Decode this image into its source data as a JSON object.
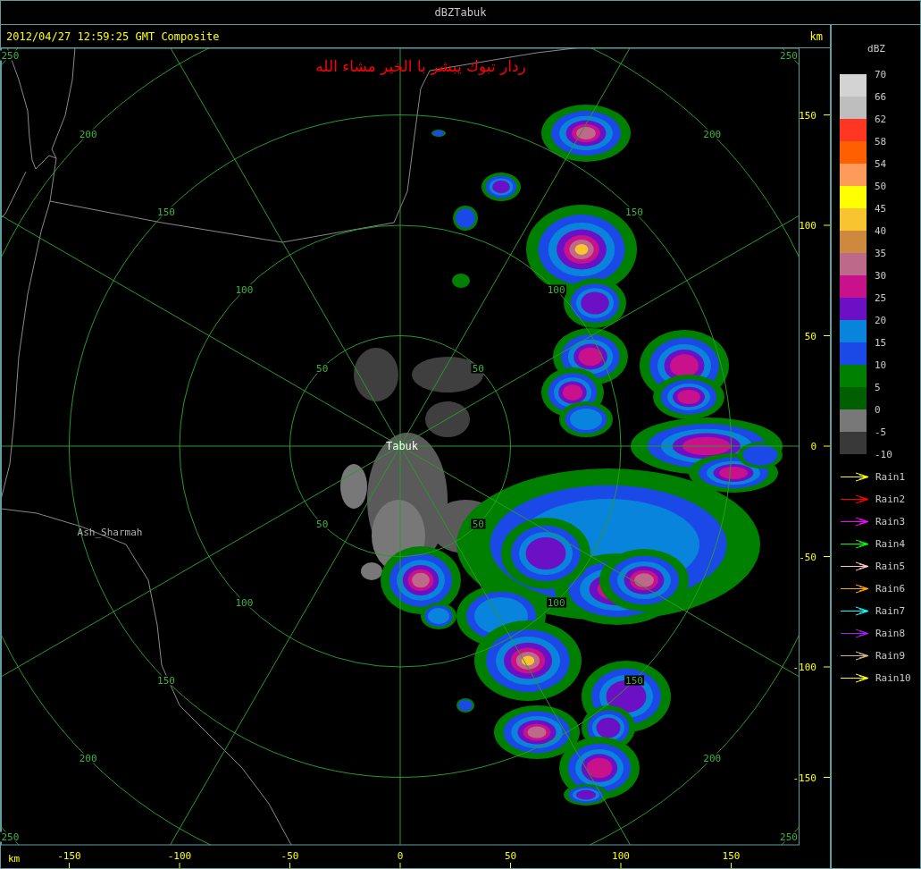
{
  "window": {
    "title": "dBZTabuk"
  },
  "header": {
    "timestamp": "2012/04/27 12:59:25 GMT Composite",
    "unit": "km"
  },
  "map": {
    "caption": "ردار تبوك يبشر با الخير مشاء الله",
    "site_label": "Tabuk",
    "place_labels": [
      "Ash_Sharmah"
    ],
    "range_rings": [
      {
        "labels": [
          "50",
          "50",
          "50",
          "50"
        ]
      },
      {
        "labels": [
          "100",
          "100",
          "100",
          "100"
        ]
      },
      {
        "labels": [
          "150",
          "150",
          "150",
          "150"
        ]
      },
      {
        "labels": [
          "200",
          "200",
          "200",
          "200"
        ]
      },
      {
        "labels": [
          "250",
          "250",
          "250",
          "250"
        ]
      }
    ]
  },
  "y_axis": {
    "ticks": [
      "150",
      "100",
      "50",
      "0",
      "-50",
      "-100",
      "-150"
    ]
  },
  "x_axis": {
    "unit": "km",
    "ticks": [
      "-150",
      "-100",
      "-50",
      "0",
      "50",
      "100",
      "150"
    ]
  },
  "color_scale": {
    "unit": "dBZ",
    "labels": [
      "70",
      "66",
      "62",
      "58",
      "54",
      "50",
      "45",
      "40",
      "35",
      "30",
      "25",
      "20",
      "15",
      "10",
      "5",
      "0",
      "-5",
      "-10"
    ],
    "swatches": [
      {
        "color": "#d3d3d3"
      },
      {
        "color": "#bebebe"
      },
      {
        "color": "#ff3621"
      },
      {
        "color": "#ff5f00"
      },
      {
        "color": "#ff9b5a"
      },
      {
        "color": "#ffff00"
      },
      {
        "color": "#f8c531"
      },
      {
        "color": "#cd893d"
      },
      {
        "color": "#bd6a8a"
      },
      {
        "color": "#c8118a"
      },
      {
        "color": "#6b10c5"
      },
      {
        "color": "#0984dc"
      },
      {
        "color": "#1b49e7"
      },
      {
        "color": "#008000"
      },
      {
        "color": "#005f00"
      },
      {
        "color": "#787878"
      },
      {
        "color": "#393939"
      }
    ]
  },
  "tracks": [
    {
      "label": "Rain1",
      "color": "#ffff00"
    },
    {
      "label": "Rain2",
      "color": "#ff0000"
    },
    {
      "label": "Rain3",
      "color": "#ff00ff"
    },
    {
      "label": "Rain4",
      "color": "#00ff00"
    },
    {
      "label": "Rain5",
      "color": "#ffc0cb"
    },
    {
      "label": "Rain6",
      "color": "#ffa500"
    },
    {
      "label": "Rain7",
      "color": "#00ffff"
    },
    {
      "label": "Rain8",
      "color": "#a020f0"
    },
    {
      "label": "Rain9",
      "color": "#d2b48c"
    },
    {
      "label": "Rain10",
      "color": "#ffff00"
    }
  ]
}
